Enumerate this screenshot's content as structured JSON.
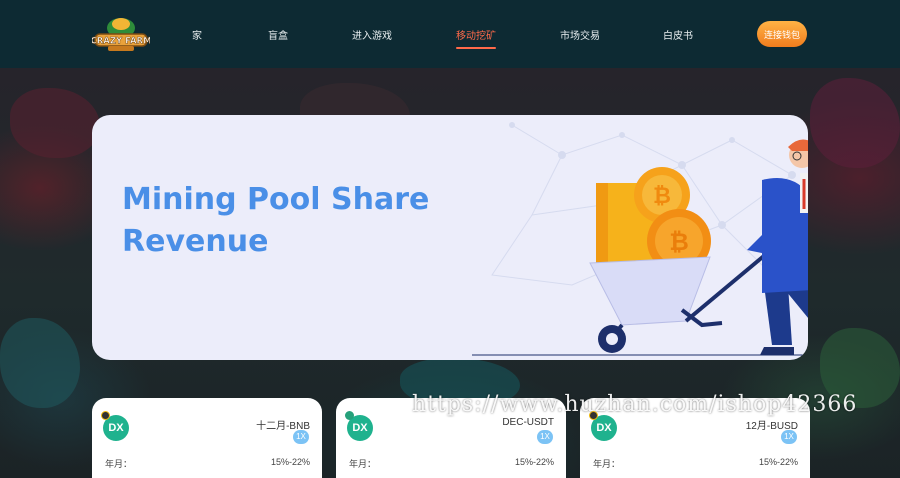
{
  "logo": {
    "text": "CRAZY FARM"
  },
  "nav": {
    "items": [
      {
        "label": "家",
        "active": false
      },
      {
        "label": "盲盒",
        "active": false
      },
      {
        "label": "进入游戏",
        "active": false
      },
      {
        "label": "移动挖矿",
        "active": true
      },
      {
        "label": "市场交易",
        "active": false
      },
      {
        "label": "白皮书",
        "active": false
      }
    ],
    "connect_label": "连接钱包"
  },
  "banner": {
    "title_line1": "Mining Pool Share",
    "title_line2": "Revenue"
  },
  "cards": [
    {
      "pair": "十二月-BNB",
      "leverage": "1X",
      "apr_label": "年月：",
      "apr_value": "15%-22%",
      "coin_icon": "dec-coin-icon"
    },
    {
      "pair": "DEC-USDT",
      "leverage": "1X",
      "apr_label": "年月：",
      "apr_value": "15%-22%",
      "coin_icon": "dec-coin-icon"
    },
    {
      "pair": "12月-BUSD",
      "leverage": "1X",
      "apr_label": "年月：",
      "apr_value": "15%-22%",
      "coin_icon": "dec-coin-icon"
    }
  ],
  "watermark": "https://www.huzhan.com/ishop42366",
  "colors": {
    "nav_bg": "#0d2a33",
    "active": "#ff6a4a",
    "accent_orange": "#f7911f",
    "banner_bg": "#ecedfa",
    "title_blue": "#4a8fe7",
    "coin_green": "#1fb28e"
  }
}
